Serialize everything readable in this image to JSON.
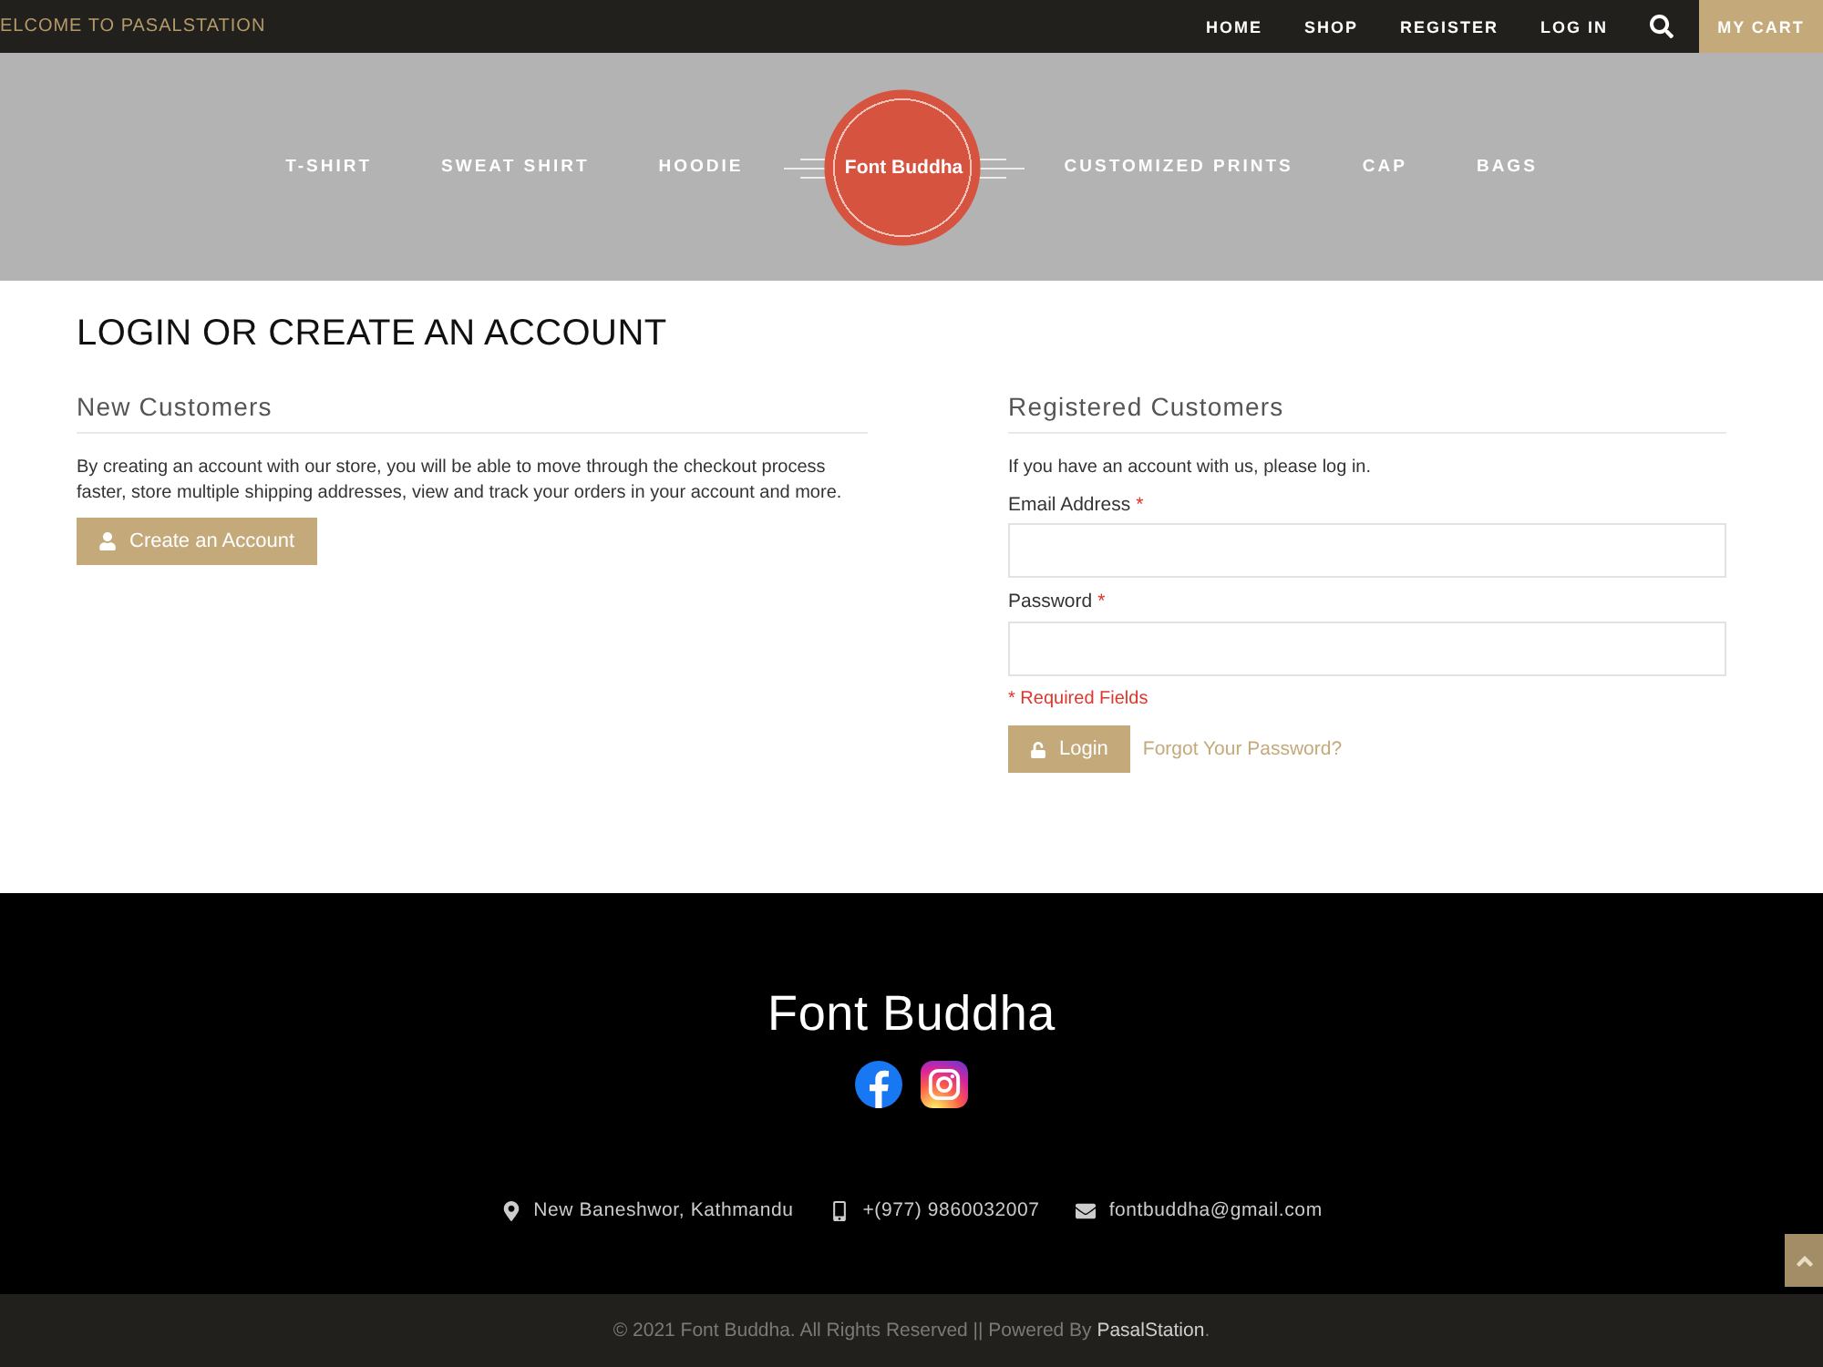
{
  "top_bar": {
    "welcome": "ELCOME TO PASALSTATION",
    "links": [
      "HOME",
      "SHOP",
      "REGISTER",
      "LOG IN"
    ],
    "cart": "MY CART"
  },
  "nav": {
    "left_items": [
      "T-SHIRT",
      "SWEAT SHIRT",
      "HOODIE"
    ],
    "logo": "Font Buddha",
    "right_items": [
      "CUSTOMIZED PRINTS",
      "CAP",
      "BAGS"
    ]
  },
  "page_title": "LOGIN OR CREATE AN ACCOUNT",
  "new_customers": {
    "heading": "New Customers",
    "text": "By creating an account with our store, you will be able to move through the checkout process faster, store multiple shipping addresses, view and track your orders in your account and more.",
    "button": "Create an Account"
  },
  "registered_customers": {
    "heading": "Registered Customers",
    "intro": "If you have an account with us, please log in.",
    "fields": [
      {
        "label": "Email Address",
        "required_mark": "*"
      },
      {
        "label": "Password",
        "required_mark": "*"
      }
    ],
    "required_note": "* Required Fields",
    "login_button": "Login",
    "forgot_link": "Forgot Your Password?"
  },
  "footer": {
    "brand": "Font Buddha",
    "social": [
      {
        "kind": "facebook"
      },
      {
        "kind": "instagram"
      }
    ],
    "contacts": [
      {
        "kind": "location",
        "text": "New Baneshwor, Kathmandu"
      },
      {
        "kind": "phone",
        "text": "+(977) 9860032007"
      },
      {
        "kind": "email",
        "text": "fontbuddha@gmail.com"
      }
    ]
  },
  "copyright": {
    "text": "© 2021 Font Buddha. All Rights Reserved || Powered By",
    "link": "PasalStation",
    "suffix": "."
  }
}
